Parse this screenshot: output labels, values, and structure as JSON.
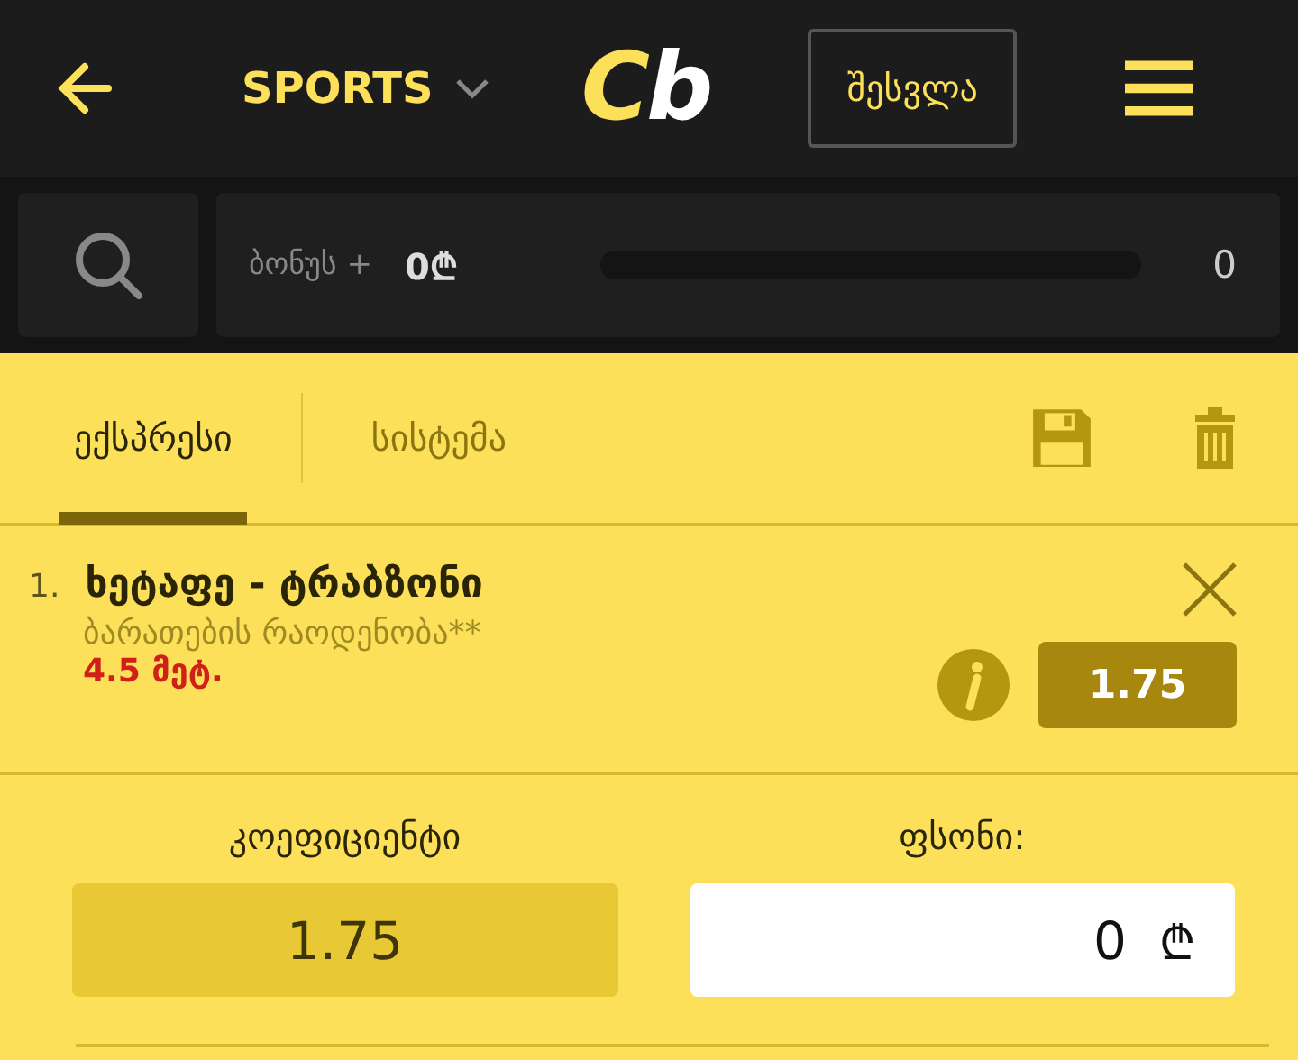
{
  "header": {
    "section": "SPORTS",
    "logo": {
      "first": "C",
      "second": "b"
    },
    "login_button": "შესვლა"
  },
  "bonus_bar": {
    "label": "ბონუს +",
    "amount": "0₾",
    "level": 0,
    "count": "0"
  },
  "tabs": [
    {
      "label": "ექსპრესი",
      "selected": true
    },
    {
      "label": "სისტემა",
      "selected": false
    }
  ],
  "bets": [
    {
      "number": "1.",
      "match": "ხეტაფე - ტრაბზონი",
      "market": "ბარათების რაოდენობა**",
      "pick": "4.5 მეტ.",
      "odds": "1.75"
    }
  ],
  "summary": {
    "odds_label": "კოეფიციენტი",
    "odds_value": "1.75",
    "stake_label": "ფსონი:",
    "stake_value": "0",
    "currency": "₾"
  }
}
